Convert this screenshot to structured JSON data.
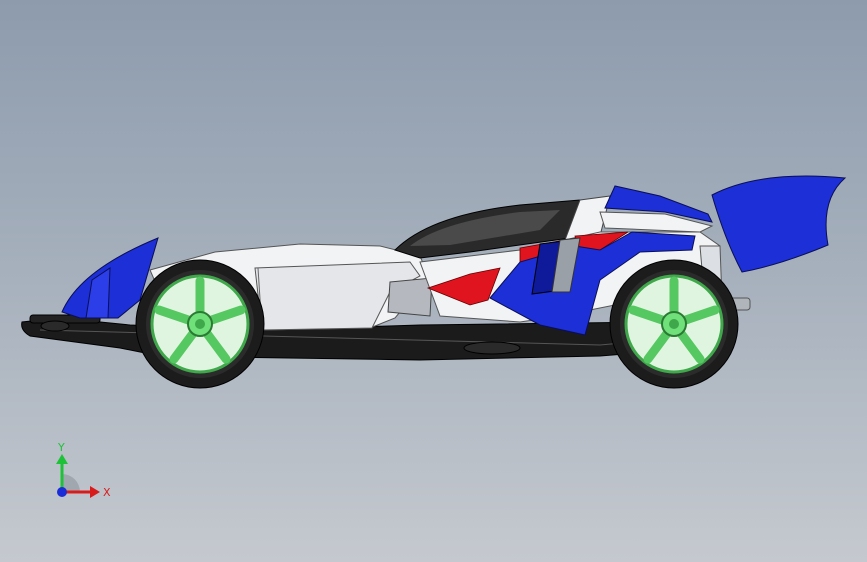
{
  "view": {
    "background_top": "#8d9bad",
    "background_bottom": "#c5c9cf"
  },
  "model": {
    "colors": {
      "blue": "#1d2fd6",
      "dark_blue": "#0f1a9a",
      "red": "#e0141e",
      "white": "#f2f3f5",
      "shade": "#d0d3d8",
      "black": "#1b1b1b",
      "rim_green": "#6fe07a"
    }
  },
  "triad": {
    "x_label": "X",
    "y_label": "Y",
    "x_color": "#d81c1c",
    "y_color": "#1ec238",
    "z_color": "#1a2cd8"
  }
}
